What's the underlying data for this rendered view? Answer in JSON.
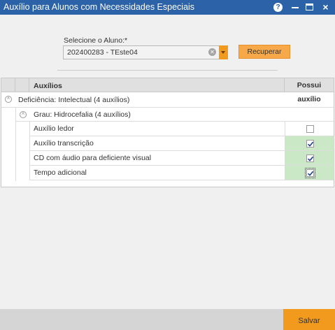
{
  "window": {
    "title": "Auxílio para Alunos com Necessidades Especiais",
    "help_label": "?",
    "close_label": "×"
  },
  "form": {
    "student_label": "Selecione o Aluno:*",
    "student_value": "202400283 - TEste04",
    "recover_button": "Recuperar"
  },
  "grid": {
    "columns": {
      "auxilios": "Auxílios",
      "possui": "Possui auxílio"
    },
    "group": {
      "label": "Deficiência: Intelectual (4 auxílios)",
      "subgroup": "Grau: Hidrocefalia (4 auxílios)"
    },
    "items": [
      {
        "label": "Auxílio ledor",
        "checked": false
      },
      {
        "label": "Auxílio transcrição",
        "checked": true
      },
      {
        "label": "CD com áudio para deficiente visual",
        "checked": true
      },
      {
        "label": "Tempo adicional",
        "checked": true
      }
    ]
  },
  "footer": {
    "save_button": "Salvar"
  },
  "colors": {
    "titlebar": "#2b62a8",
    "accent": "#f29a1e",
    "checked_cell": "#cbe8c6"
  },
  "icons": {
    "help": "help-icon",
    "minimize": "minimize-icon",
    "maximize": "maximize-icon",
    "close": "close-icon",
    "clear": "clear-icon",
    "dropdown": "chevron-down-icon",
    "expander": "collapse-icon"
  }
}
